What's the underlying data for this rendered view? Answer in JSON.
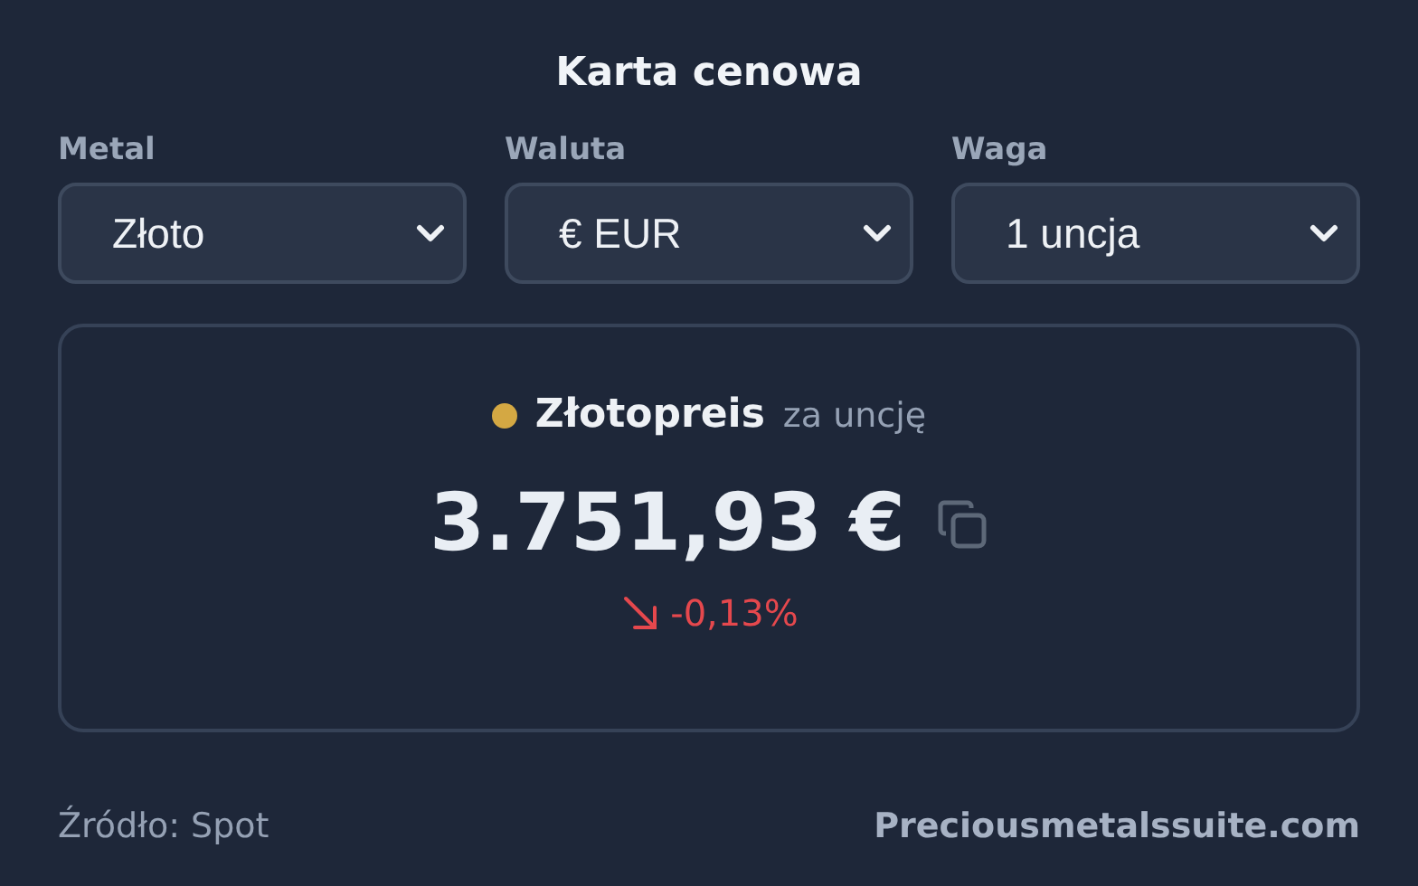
{
  "title": "Karta cenowa",
  "selectors": [
    {
      "label": "Metal",
      "value": "Złoto"
    },
    {
      "label": "Waluta",
      "value": "€ EUR"
    },
    {
      "label": "Waga",
      "value": "1 uncja"
    }
  ],
  "price_card": {
    "color": "#d4a843",
    "metal_name": "Złotopreis",
    "unit": "za uncję",
    "price": "3.751,93 €",
    "change": "-0,13%",
    "kind": "down"
  },
  "footer": {
    "source": "Źródło: Spot",
    "link": "Preciousmetalssuite.com"
  }
}
